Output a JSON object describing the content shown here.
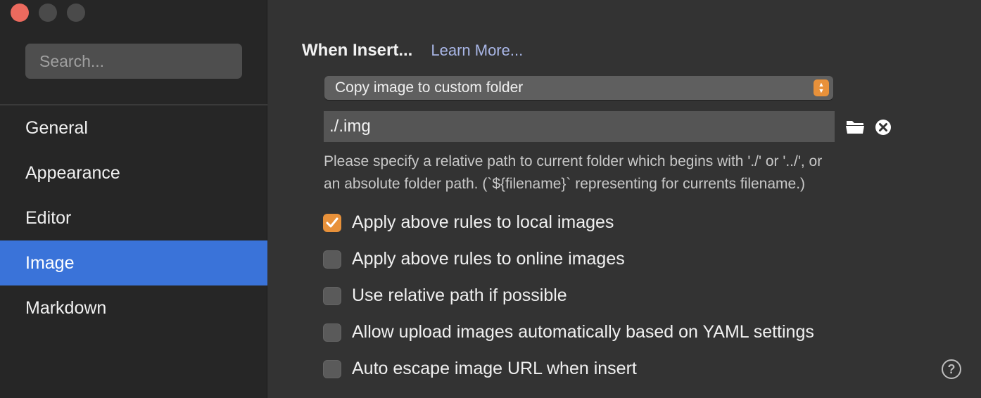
{
  "window": {
    "traffic_lights": [
      "close",
      "minimize",
      "zoom"
    ],
    "colors": {
      "close": "#ec6a5e",
      "inactive": "#4a4a4a"
    }
  },
  "sidebar": {
    "search": {
      "placeholder": "Search...",
      "value": ""
    },
    "items": [
      {
        "label": "General",
        "active": false
      },
      {
        "label": "Appearance",
        "active": false
      },
      {
        "label": "Editor",
        "active": false
      },
      {
        "label": "Image",
        "active": true
      },
      {
        "label": "Markdown",
        "active": false
      }
    ],
    "active_color": "#3a73d9"
  },
  "main": {
    "heading": "When Insert...",
    "learn_more": "Learn More...",
    "insert_action": {
      "selected": "Copy image to custom folder"
    },
    "folder_path": {
      "value": "./.img"
    },
    "hint_line1": " Please specify a relative path to current folder which begins with './' or '../', or",
    "hint_line2": "an absolute folder path. (`${filename}` representing for currents filename.)",
    "options": [
      {
        "label": "Apply above rules to local images",
        "checked": true
      },
      {
        "label": "Apply above rules to online images",
        "checked": false
      },
      {
        "label": "Use relative path if possible",
        "checked": false
      },
      {
        "label": "Allow upload images automatically based on YAML settings",
        "checked": false
      },
      {
        "label": "Auto escape image URL when insert",
        "checked": false
      }
    ],
    "accent_color": "#e8913a",
    "help_label": "?"
  }
}
